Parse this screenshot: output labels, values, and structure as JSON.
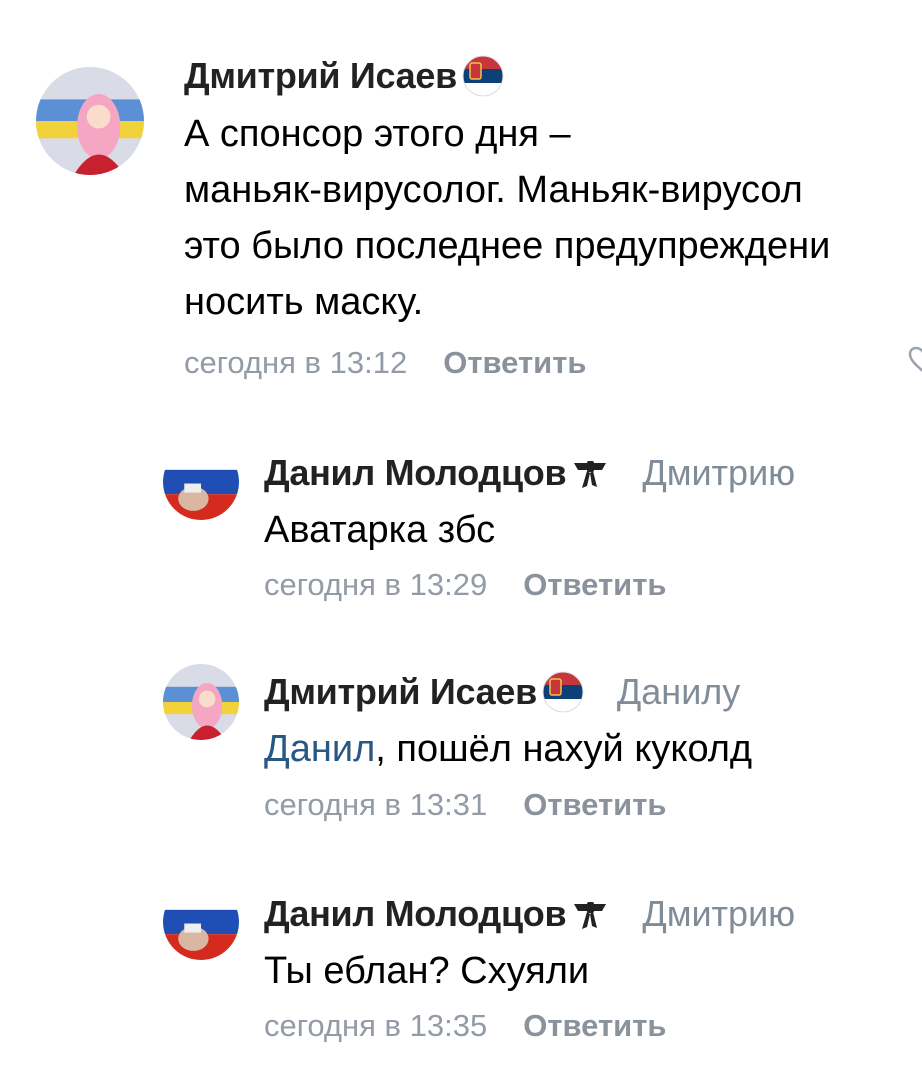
{
  "comments": [
    {
      "author": "Дмитрий Исаев",
      "reply_to": "",
      "lines": [
        "А спонсор этого дня –",
        "маньяк-вирусолог. Маньяк-вирусол",
        "это было последнее предупреждени",
        "носить маску."
      ],
      "time": "сегодня в 13:12",
      "reply_label": "Ответить",
      "badge": "serbia-flag-icon"
    },
    {
      "author": "Данил Молодцов",
      "reply_to": "Дмитрию",
      "text": "Аватарка збс",
      "time": "сегодня в 13:29",
      "reply_label": "Ответить",
      "badge": "ribbon-icon"
    },
    {
      "author": "Дмитрий Исаев",
      "reply_to": "Данилу",
      "mention": "Данил",
      "text_rest": ", пошёл нахуй куколд",
      "time": "сегодня в 13:31",
      "reply_label": "Ответить",
      "badge": "serbia-flag-icon"
    },
    {
      "author": "Данил Молодцов",
      "reply_to": "Дмитрию",
      "text": "Ты еблан? Схуяли",
      "time": "сегодня в 13:35",
      "reply_label": "Ответить",
      "badge": "ribbon-icon"
    }
  ],
  "colors": {
    "link": "#2a5885",
    "secondary": "#818c99",
    "meta": "#939ba6"
  }
}
